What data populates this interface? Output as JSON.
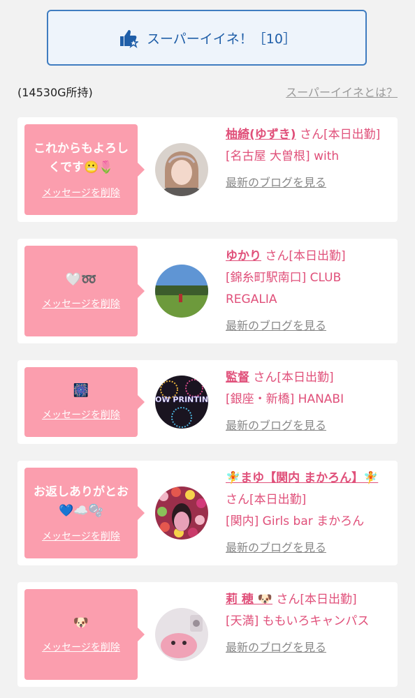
{
  "super_like": {
    "label": "スーパーイイネ！［10］",
    "icon": "thumbs-up-star-icon"
  },
  "points": "(14530G所持)",
  "about_link": "スーパーイイネとは？",
  "cards": [
    {
      "message_line1": "これからもよろし",
      "message_line2": "くです😬🌷",
      "delete_label": "メッセージを削除",
      "name": "柚綺(ゆずき)",
      "san": "さん[本日出勤]",
      "shop": "[名古屋 大曽根] with",
      "blog": "最新のブログを見る"
    },
    {
      "message_line1": "🤍➿",
      "delete_label": "メッセージを削除",
      "name": "ゆかり",
      "san": "さん[本日出勤]",
      "shop": "[錦糸町駅南口] CLUB REGALIA",
      "blog": "最新のブログを見る"
    },
    {
      "message_line1": "🎆",
      "delete_label": "メッセージを削除",
      "name": "監督",
      "san": "さん[本日出勤]",
      "shop": "[銀座・新橋] HANABI",
      "blog": "最新のブログを見る",
      "avatar_text": "NOW PRINTING"
    },
    {
      "message_line1": "お返しありがとお",
      "message_line2": "💙☁️🫧",
      "delete_label": "メッセージを削除",
      "name": "🧚まゆ【関内 まかろん】🧚",
      "san": "さん[本日出勤]",
      "shop": "[関内] Girls bar まかろん",
      "blog": "最新のブログを見る"
    },
    {
      "message_line1": "🐶",
      "delete_label": "メッセージを削除",
      "name": "莉 穂 🐶",
      "san": "さん[本日出勤]",
      "shop": "[天満] ももいろキャンパス",
      "blog": "最新のブログを見る"
    }
  ],
  "colors": {
    "accent_blue": "#1f5ea8",
    "bubble_pink": "#fb9eae",
    "name_pink": "#e0507a"
  }
}
